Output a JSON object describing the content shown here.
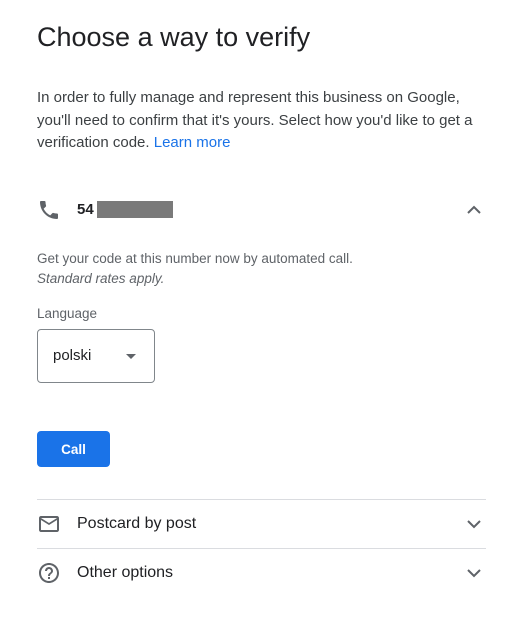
{
  "header": {
    "title": "Choose a way to verify"
  },
  "intro": {
    "text": "In order to fully manage and represent this business on Google, you'll need to confirm that it's yours. Select how you'd like to get a verification code.",
    "learn_more": "Learn more"
  },
  "phone_option": {
    "number_prefix": "54",
    "icon": "phone-icon",
    "expanded": true,
    "description": "Get your code at this number now by automated call.",
    "rates_note": "Standard rates apply.",
    "language_label": "Language",
    "language_value": "polski",
    "call_button": "Call"
  },
  "other_methods": [
    {
      "label": "Postcard by post",
      "icon": "mail-icon"
    },
    {
      "label": "Other options",
      "icon": "help-circle-icon"
    }
  ],
  "colors": {
    "accent": "#1a73e8",
    "text_primary": "#202124",
    "text_secondary": "#5f6368",
    "divider": "#dadce0",
    "redaction": "#7a7a7a"
  }
}
